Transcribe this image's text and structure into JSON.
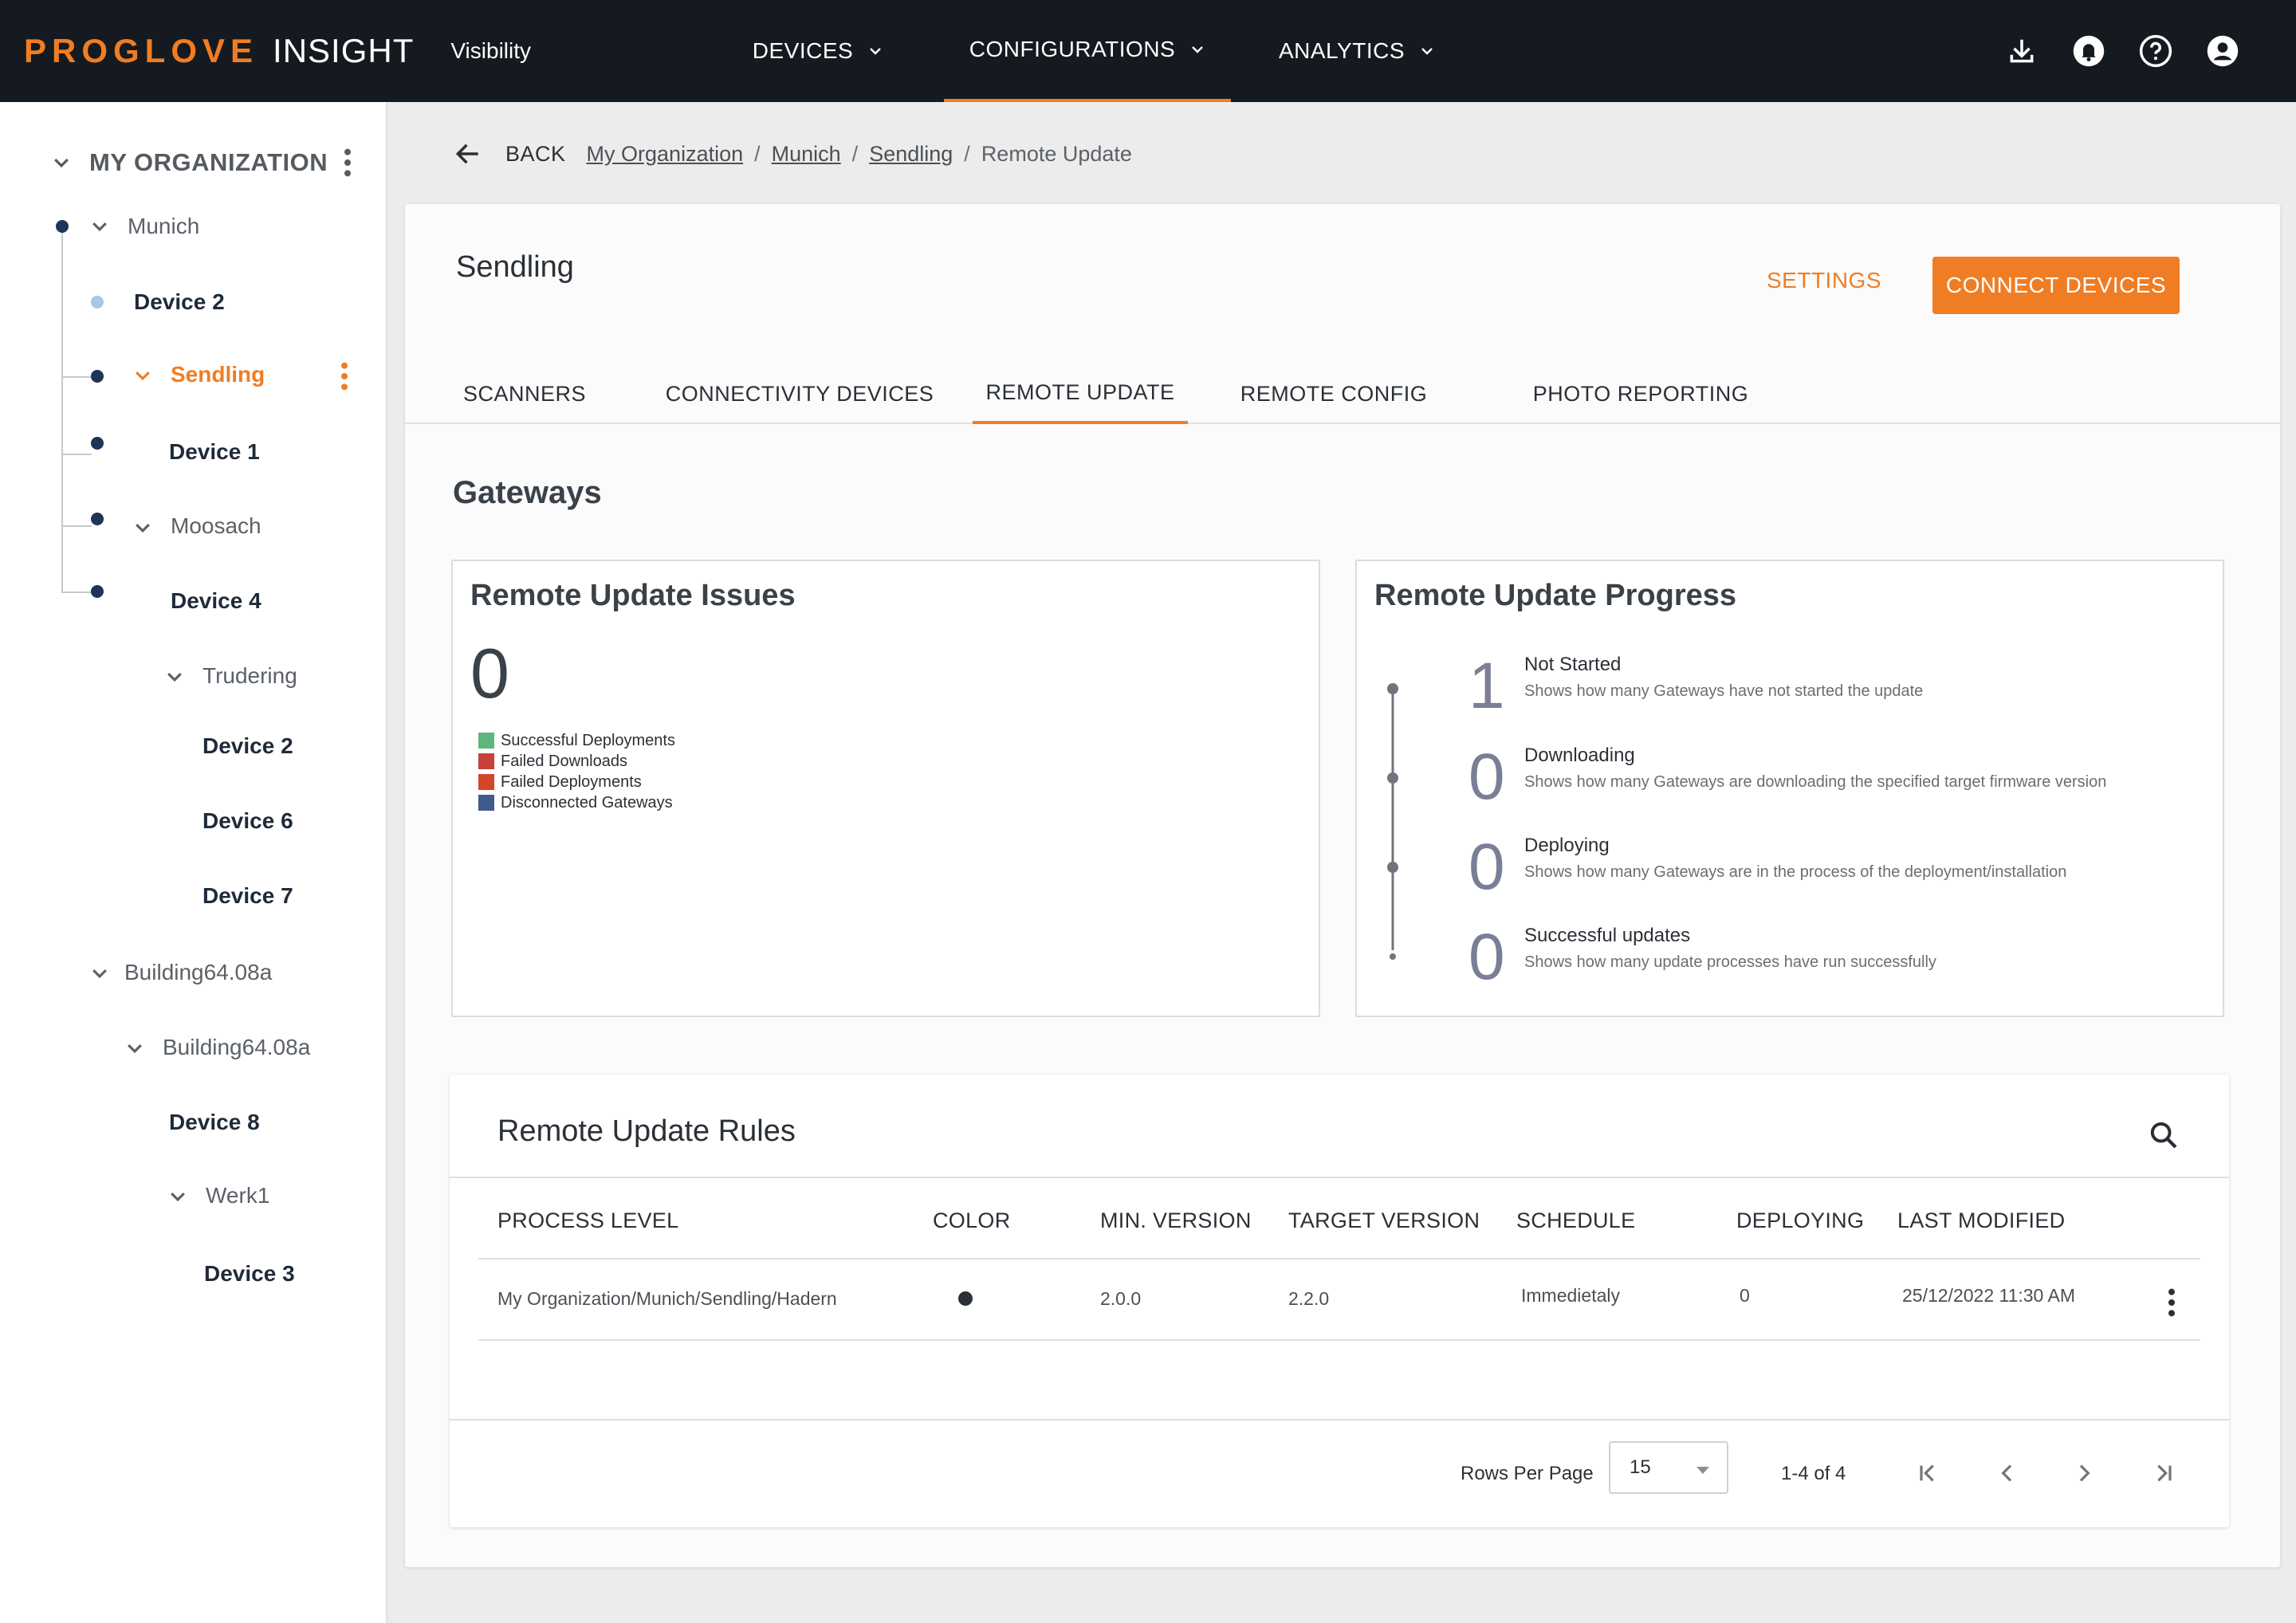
{
  "brand": {
    "logo": "PROGLOVE",
    "product": "INSIGHT",
    "subtitle": "Visibility",
    "accent_color": "#f07d23",
    "bar_color": "#141a1f"
  },
  "topnav": {
    "items": [
      {
        "label": "DEVICES"
      },
      {
        "label": "CONFIGURATIONS",
        "active": true
      },
      {
        "label": "ANALYTICS"
      }
    ],
    "icons": [
      "download-icon",
      "bell-icon",
      "help-icon",
      "account-icon"
    ]
  },
  "sidebar": {
    "org_title": "MY ORGANIZATION",
    "tree": [
      {
        "label": "Munich",
        "kind": "group"
      },
      {
        "label": "Device 2",
        "kind": "device"
      },
      {
        "label": "Sendling",
        "kind": "group",
        "selected": true
      },
      {
        "label": "Device 1",
        "kind": "device"
      },
      {
        "label": "Moosach",
        "kind": "group"
      },
      {
        "label": "Device 4",
        "kind": "device"
      },
      {
        "label": "Trudering",
        "kind": "group"
      },
      {
        "label": "Device 2",
        "kind": "device"
      },
      {
        "label": "Device 6",
        "kind": "device"
      },
      {
        "label": "Device 7",
        "kind": "device"
      },
      {
        "label": "Building64.08a",
        "kind": "group"
      },
      {
        "label": "Building64.08a",
        "kind": "group"
      },
      {
        "label": "Device 8",
        "kind": "device"
      },
      {
        "label": "Werk1",
        "kind": "group"
      },
      {
        "label": "Device 3",
        "kind": "device"
      }
    ]
  },
  "breadcrumb": {
    "back_label": "BACK",
    "links": [
      "My Organization",
      "Munich",
      "Sendling"
    ],
    "current": "Remote Update"
  },
  "page": {
    "title": "Sendling",
    "settings_label": "SETTINGS",
    "connect_label": "CONNECT DEVICES",
    "tabs": [
      {
        "label": "SCANNERS"
      },
      {
        "label": "CONNECTIVITY DEVICES"
      },
      {
        "label": "REMOTE UPDATE",
        "active": true
      },
      {
        "label": "REMOTE CONFIG"
      },
      {
        "label": "PHOTO REPORTING"
      }
    ],
    "section_title": "Gateways"
  },
  "issues": {
    "title": "Remote Update Issues",
    "count": "0",
    "legend": [
      {
        "label": "Successful Deployments",
        "color": "#5cb87a"
      },
      {
        "label": "Failed Downloads",
        "color": "#c8413b"
      },
      {
        "label": "Failed Deployments",
        "color": "#d4452a"
      },
      {
        "label": "Disconnected Gateways",
        "color": "#3f5a8c"
      }
    ]
  },
  "progress": {
    "title": "Remote Update Progress",
    "steps": [
      {
        "value": "1",
        "label": "Not Started",
        "desc": "Shows how many Gateways have not started the update"
      },
      {
        "value": "0",
        "label": "Downloading",
        "desc": "Shows how many Gateways are downloading the specified target firmware version"
      },
      {
        "value": "0",
        "label": "Deploying",
        "desc": "Shows how many Gateways are in the process of the deployment/installation"
      },
      {
        "value": "0",
        "label": "Successful updates",
        "desc": "Shows how many update processes have run successfully"
      }
    ]
  },
  "rules": {
    "title": "Remote Update Rules",
    "columns": [
      "PROCESS LEVEL",
      "COLOR",
      "MIN. VERSION",
      "TARGET VERSION",
      "SCHEDULE",
      "DEPLOYING",
      "LAST MODIFIED"
    ],
    "rows": [
      {
        "process_level": "My Organization/Munich/Sendling/Hadern",
        "color": "#2b3036",
        "min_version": "2.0.0",
        "target_version": "2.2.0",
        "schedule": "Immedietaly",
        "deploying": "0",
        "last_modified": "25/12/2022 11:30 AM"
      }
    ],
    "footer": {
      "rows_per_page_label": "Rows Per Page",
      "rows_per_page_value": "15",
      "range": "1-4 of 4"
    }
  }
}
